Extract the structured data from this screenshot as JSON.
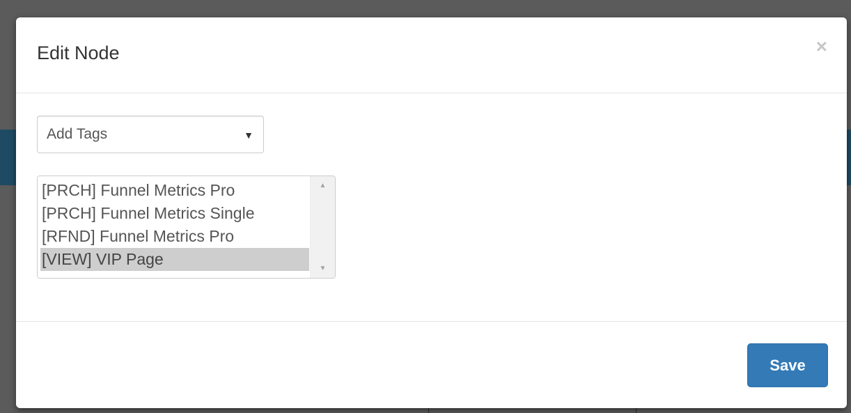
{
  "modal": {
    "title": "Edit Node",
    "close_symbol": "×"
  },
  "tags_dropdown": {
    "selected_value": "Add Tags",
    "arrow_symbol": "▼"
  },
  "tag_list": {
    "items": [
      {
        "label": "[PRCH] Funnel Metrics Pro",
        "selected": false
      },
      {
        "label": "[PRCH] Funnel Metrics Single",
        "selected": false
      },
      {
        "label": "[RFND] Funnel Metrics Pro",
        "selected": false
      },
      {
        "label": "[VIEW] VIP Page",
        "selected": true
      }
    ],
    "scroll_up_symbol": "▲",
    "scroll_down_symbol": "▼"
  },
  "footer": {
    "save_label": "Save"
  },
  "colors": {
    "primary_button": "#337ab7",
    "selected_item": "#cecece",
    "background_band": "#1f4a63"
  }
}
